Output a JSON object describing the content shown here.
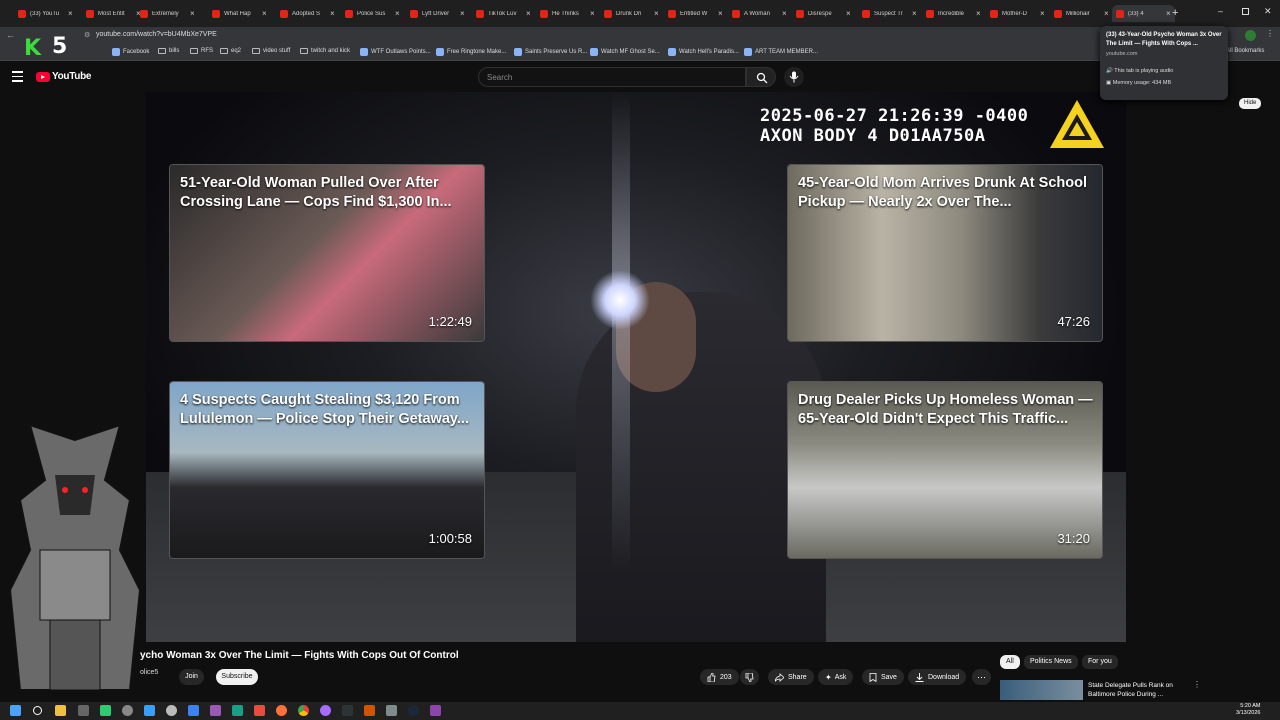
{
  "tabs": [
    {
      "label": "(33) YouTu",
      "active": false
    },
    {
      "label": "Most Entit",
      "active": false
    },
    {
      "label": "Extremely",
      "active": false
    },
    {
      "label": "What Hap",
      "active": false
    },
    {
      "label": "Adopted S",
      "active": false
    },
    {
      "label": "Police Sus",
      "active": false
    },
    {
      "label": "Lyft Driver",
      "active": false
    },
    {
      "label": "TikTok Luv",
      "active": false
    },
    {
      "label": "He Thinks",
      "active": false
    },
    {
      "label": "Drunk Dri",
      "active": false
    },
    {
      "label": "Entitled W",
      "active": false
    },
    {
      "label": "A Woman",
      "active": false
    },
    {
      "label": "Disrespe",
      "active": false
    },
    {
      "label": "Suspect Tr",
      "active": false
    },
    {
      "label": "Incredible",
      "active": false
    },
    {
      "label": "Mother-D",
      "active": false
    },
    {
      "label": "Millionair",
      "active": false
    },
    {
      "label": "(33) 4",
      "active": true
    }
  ],
  "browser": {
    "url": "youtube.com/watch?v=bU4MbXe7VPE",
    "all_bookmarks": "All Bookmarks"
  },
  "bookmarks": [
    {
      "label": "Facebook",
      "icon": "facebook-icon"
    },
    {
      "label": "bills",
      "icon": "folder-icon"
    },
    {
      "label": "RFS",
      "icon": "folder-icon"
    },
    {
      "label": "eq2",
      "icon": "folder-icon"
    },
    {
      "label": "video stuff",
      "icon": "folder-icon"
    },
    {
      "label": "twitch and kick",
      "icon": "folder-icon"
    },
    {
      "label": "WTF Outlaws Points...",
      "icon": "bookmark-icon"
    },
    {
      "label": "Free Ringtone Make...",
      "icon": "bookmark-icon"
    },
    {
      "label": "Saints Preserve Us R...",
      "icon": "bookmark-icon"
    },
    {
      "label": "Watch MF Ghost Se...",
      "icon": "bookmark-icon"
    },
    {
      "label": "Watch Hell's Paradis...",
      "icon": "bookmark-icon"
    },
    {
      "label": "ART TEAM MEMBER...",
      "icon": "bookmark-icon"
    }
  ],
  "tab_tooltip": {
    "title": "(33) 43-Year-Old Psycho Woman 3x Over The Limit — Fights With Cops ...",
    "domain": "youtube.com",
    "audio": "This tab is playing audio",
    "memory": "Memory usage: 434 MB"
  },
  "youtube": {
    "logo": "YouTube",
    "search_placeholder": "Search",
    "hide_label": "Hide"
  },
  "video": {
    "timestamp_line1": "2025-06-27 21:26:39 -0400",
    "timestamp_line2": "AXON BODY 4 D01AA750A"
  },
  "end_cards": [
    {
      "title": "51-Year-Old Woman Pulled Over After Crossing Lane — Cops Find $1,300 In...",
      "duration": "1:22:49"
    },
    {
      "title": "45-Year-Old Mom Arrives Drunk At School Pickup — Nearly 2x Over The...",
      "duration": "47:26"
    },
    {
      "title": "4 Suspects Caught Stealing $3,120 From Lululemon — Police Stop Their Getaway...",
      "duration": "1:00:58"
    },
    {
      "title": "Drug Dealer Picks Up Homeless Woman — 65-Year-Old Didn't Expect This Traffic...",
      "duration": "31:20"
    }
  ],
  "watch": {
    "title": "ycho Woman 3x Over The Limit — Fights With Cops Out Of Control",
    "channel": "olice5",
    "join": "Join",
    "subscribe": "Subscribe",
    "likes": "203",
    "share": "Share",
    "ask": "Ask",
    "save": "Save",
    "download": "Download"
  },
  "chips": [
    "All",
    "Politics News",
    "For you"
  ],
  "recommendation": {
    "title": "State Delegate Pulls Rank on Baltimore Police During ..."
  },
  "overlay": {
    "logo_k": "K",
    "logo_5": "5"
  },
  "taskbar": {
    "time": "5:20 AM",
    "date": "3/13/2026"
  },
  "colors": {
    "youtube_red": "#ff0033",
    "background": "#0f0f0f",
    "subscribe_bg": "#f1f1f1"
  }
}
